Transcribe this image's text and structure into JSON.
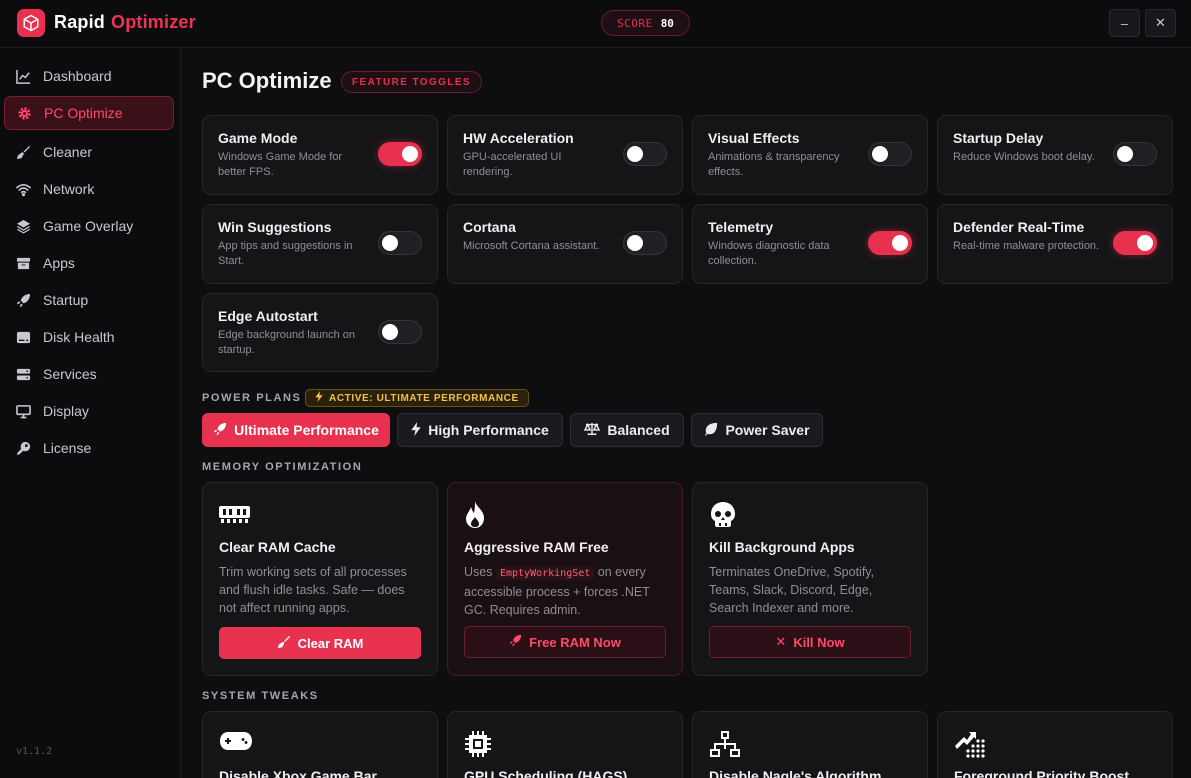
{
  "app": {
    "title_first": "Rapid",
    "title_second": "Optimizer",
    "version": "v1.1.2"
  },
  "score": {
    "label": "SCORE",
    "value": "80"
  },
  "window": {
    "minimize": "–",
    "close": "✕"
  },
  "sidebar": {
    "items": [
      {
        "label": "Dashboard",
        "icon": "chart-line-icon",
        "active": false
      },
      {
        "label": "PC Optimize",
        "icon": "gear-icon",
        "active": true
      },
      {
        "label": "Cleaner",
        "icon": "broom-icon",
        "active": false
      },
      {
        "label": "Network",
        "icon": "wifi-icon",
        "active": false
      },
      {
        "label": "Game Overlay",
        "icon": "layers-icon",
        "active": false
      },
      {
        "label": "Apps",
        "icon": "box-icon",
        "active": false
      },
      {
        "label": "Startup",
        "icon": "rocket-icon",
        "active": false
      },
      {
        "label": "Disk Health",
        "icon": "hdd-icon",
        "active": false
      },
      {
        "label": "Services",
        "icon": "server-icon",
        "active": false
      },
      {
        "label": "Display",
        "icon": "monitor-icon",
        "active": false
      },
      {
        "label": "License",
        "icon": "key-icon",
        "active": false
      }
    ]
  },
  "page": {
    "title": "PC Optimize",
    "badge": "FEATURE TOGGLES"
  },
  "toggles": [
    {
      "title": "Game Mode",
      "desc": "Windows Game Mode for better FPS.",
      "on": true
    },
    {
      "title": "HW Acceleration",
      "desc": "GPU-accelerated UI rendering.",
      "on": false
    },
    {
      "title": "Visual Effects",
      "desc": "Animations & transparency effects.",
      "on": false
    },
    {
      "title": "Startup Delay",
      "desc": "Reduce Windows boot delay.",
      "on": false
    },
    {
      "title": "Win Suggestions",
      "desc": "App tips and suggestions in Start.",
      "on": false
    },
    {
      "title": "Cortana",
      "desc": "Microsoft Cortana assistant.",
      "on": false
    },
    {
      "title": "Telemetry",
      "desc": "Windows diagnostic data collection.",
      "on": true
    },
    {
      "title": "Defender Real-Time",
      "desc": "Real-time malware protection.",
      "on": true
    },
    {
      "title": "Edge Autostart",
      "desc": "Edge background launch on startup.",
      "on": false
    }
  ],
  "power": {
    "section_label": "POWER PLANS",
    "active_label": "ACTIVE: ULTIMATE PERFORMANCE",
    "plans": [
      {
        "label": "Ultimate Performance",
        "icon": "rocket-icon",
        "active": true
      },
      {
        "label": "High Performance",
        "icon": "bolt-icon",
        "active": false
      },
      {
        "label": "Balanced",
        "icon": "scale-icon",
        "active": false
      },
      {
        "label": "Power Saver",
        "icon": "leaf-icon",
        "active": false
      }
    ]
  },
  "memory": {
    "section_label": "MEMORY OPTIMIZATION",
    "cards": [
      {
        "title": "Clear RAM Cache",
        "desc": "Trim working sets of all processes and flush idle tasks. Safe — does not affect running apps.",
        "button": "Clear RAM",
        "icon": "memory-icon",
        "style": "solid"
      },
      {
        "title": "Aggressive RAM Free",
        "desc_pre": "Uses",
        "desc_code": "EmptyWorkingSet",
        "desc_post": "on every accessible process + forces .NET GC. Requires admin.",
        "button": "Free RAM Now",
        "icon": "flame-icon",
        "style": "outline"
      },
      {
        "title": "Kill Background Apps",
        "desc": "Terminates OneDrive, Spotify, Teams, Slack, Discord, Edge, Search Indexer and more.",
        "button": "Kill Now",
        "icon": "skull-icon",
        "style": "outline"
      }
    ]
  },
  "tweaks": {
    "section_label": "SYSTEM TWEAKS",
    "cards": [
      {
        "title": "Disable Xbox Game Bar",
        "icon": "gamepad-icon"
      },
      {
        "title": "GPU Scheduling (HAGS)",
        "icon": "chip-icon"
      },
      {
        "title": "Disable Nagle's Algorithm",
        "icon": "network-tree-icon"
      },
      {
        "title": "Foreground Priority Boost",
        "icon": "priority-boost-icon"
      }
    ]
  },
  "colors": {
    "accent": "#e8304f",
    "gold": "#f1c04a",
    "background": "#0e0e11",
    "card": "#151518"
  }
}
